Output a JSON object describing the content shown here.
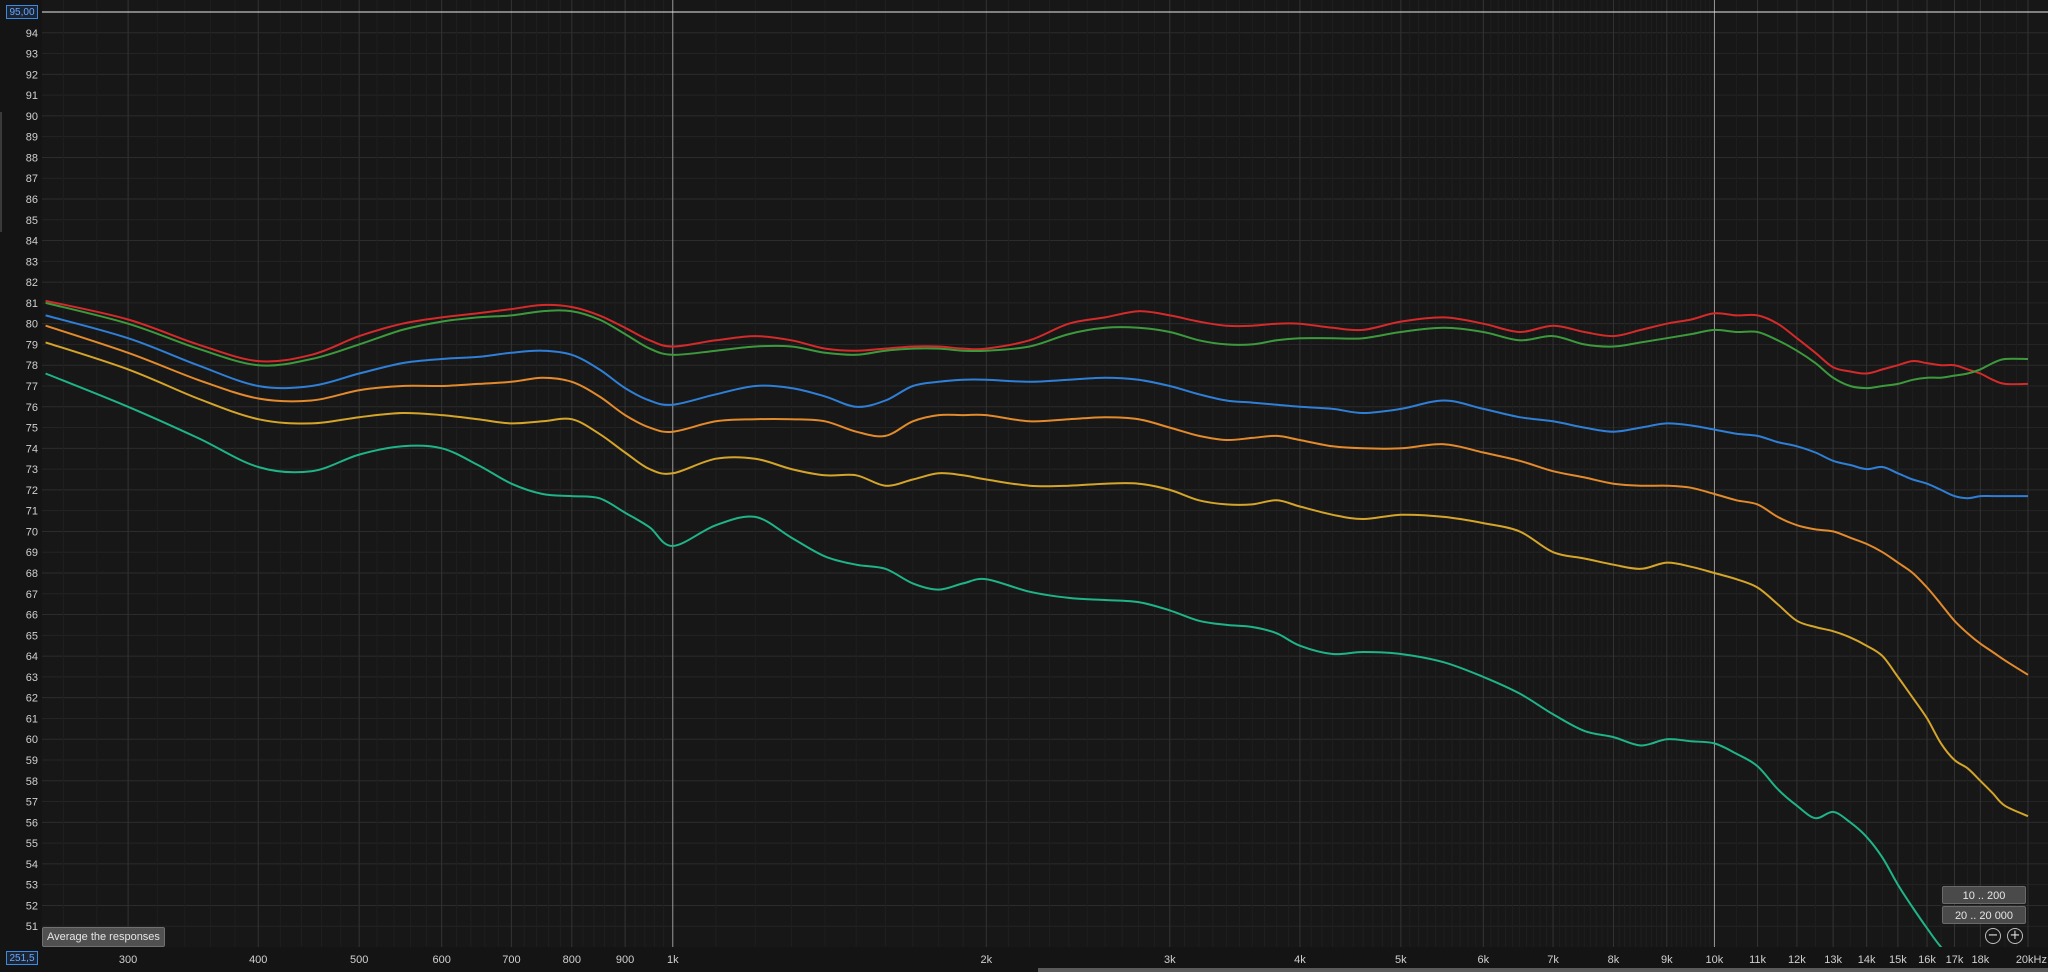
{
  "chart_data": {
    "type": "line",
    "xscale": "log",
    "xlim": [
      248,
      20000
    ],
    "ylim": [
      50,
      95
    ],
    "grid": true,
    "y_ticks": [
      51,
      52,
      53,
      54,
      55,
      56,
      57,
      58,
      59,
      60,
      61,
      62,
      63,
      64,
      65,
      66,
      67,
      68,
      69,
      70,
      71,
      72,
      73,
      74,
      75,
      76,
      77,
      78,
      79,
      80,
      81,
      82,
      83,
      84,
      85,
      86,
      87,
      88,
      89,
      90,
      91,
      92,
      93,
      94
    ],
    "x_ticks": [
      {
        "v": 300,
        "label": "300"
      },
      {
        "v": 400,
        "label": "400"
      },
      {
        "v": 500,
        "label": "500"
      },
      {
        "v": 600,
        "label": "600"
      },
      {
        "v": 700,
        "label": "700"
      },
      {
        "v": 800,
        "label": "800"
      },
      {
        "v": 900,
        "label": "900"
      },
      {
        "v": 1000,
        "label": "1k"
      },
      {
        "v": 2000,
        "label": "2k"
      },
      {
        "v": 3000,
        "label": "3k"
      },
      {
        "v": 4000,
        "label": "4k"
      },
      {
        "v": 5000,
        "label": "5k"
      },
      {
        "v": 6000,
        "label": "6k"
      },
      {
        "v": 7000,
        "label": "7k"
      },
      {
        "v": 8000,
        "label": "8k"
      },
      {
        "v": 9000,
        "label": "9k"
      },
      {
        "v": 10000,
        "label": "10k"
      },
      {
        "v": 11000,
        "label": "11k"
      },
      {
        "v": 12000,
        "label": "12k"
      },
      {
        "v": 13000,
        "label": "13k"
      },
      {
        "v": 14000,
        "label": "14k"
      },
      {
        "v": 15000,
        "label": "15k"
      },
      {
        "v": 16000,
        "label": "16k"
      },
      {
        "v": 17000,
        "label": "17k"
      },
      {
        "v": 18000,
        "label": "18k"
      },
      {
        "v": 20000,
        "label": "20kHz"
      }
    ],
    "x": [
      250,
      300,
      350,
      400,
      450,
      500,
      550,
      600,
      650,
      700,
      750,
      800,
      850,
      900,
      950,
      1000,
      1100,
      1200,
      1300,
      1400,
      1500,
      1600,
      1700,
      1800,
      1900,
      2000,
      2200,
      2400,
      2600,
      2800,
      3000,
      3200,
      3400,
      3600,
      3800,
      4000,
      4300,
      4600,
      5000,
      5500,
      6000,
      6500,
      7000,
      7500,
      8000,
      8500,
      9000,
      9500,
      10000,
      10500,
      11000,
      11500,
      12000,
      12500,
      13000,
      13500,
      14000,
      14500,
      15000,
      15500,
      16000,
      16500,
      17000,
      17500,
      18000,
      18500,
      19000,
      20000
    ],
    "series": [
      {
        "color": "#d42a2a",
        "values": [
          81.1,
          80.2,
          79.0,
          78.2,
          78.5,
          79.4,
          80.0,
          80.3,
          80.5,
          80.7,
          80.9,
          80.8,
          80.4,
          79.8,
          79.2,
          78.9,
          79.2,
          79.4,
          79.2,
          78.8,
          78.7,
          78.8,
          78.9,
          78.9,
          78.8,
          78.8,
          79.2,
          80.0,
          80.3,
          80.6,
          80.4,
          80.1,
          79.9,
          79.9,
          80.0,
          80.0,
          79.8,
          79.7,
          80.1,
          80.3,
          80.0,
          79.6,
          79.9,
          79.6,
          79.4,
          79.7,
          80.0,
          80.2,
          80.5,
          80.4,
          80.4,
          80.0,
          79.3,
          78.6,
          77.9,
          77.7,
          77.6,
          77.8,
          78.0,
          78.2,
          78.1,
          78.0,
          78.0,
          77.8,
          77.6,
          77.3,
          77.1,
          77.1
        ]
      },
      {
        "color": "#3c9a3c",
        "values": [
          81.0,
          80.0,
          78.8,
          78.0,
          78.3,
          79.0,
          79.7,
          80.1,
          80.3,
          80.4,
          80.6,
          80.6,
          80.2,
          79.5,
          78.8,
          78.5,
          78.7,
          78.9,
          78.9,
          78.6,
          78.5,
          78.7,
          78.8,
          78.8,
          78.7,
          78.7,
          78.9,
          79.5,
          79.8,
          79.8,
          79.6,
          79.2,
          79.0,
          79.0,
          79.2,
          79.3,
          79.3,
          79.3,
          79.6,
          79.8,
          79.6,
          79.2,
          79.4,
          79.0,
          78.9,
          79.1,
          79.3,
          79.5,
          79.7,
          79.6,
          79.6,
          79.2,
          78.7,
          78.1,
          77.4,
          77.0,
          76.9,
          77.0,
          77.1,
          77.3,
          77.4,
          77.4,
          77.5,
          77.6,
          77.8,
          78.1,
          78.3,
          78.3
        ]
      },
      {
        "color": "#2f7fd6",
        "values": [
          80.4,
          79.3,
          78.0,
          77.0,
          77.0,
          77.6,
          78.1,
          78.3,
          78.4,
          78.6,
          78.7,
          78.5,
          77.8,
          76.9,
          76.3,
          76.1,
          76.6,
          77.0,
          76.9,
          76.5,
          76.0,
          76.3,
          77.0,
          77.2,
          77.3,
          77.3,
          77.2,
          77.3,
          77.4,
          77.3,
          77.0,
          76.6,
          76.3,
          76.2,
          76.1,
          76.0,
          75.9,
          75.7,
          75.9,
          76.3,
          75.9,
          75.5,
          75.3,
          75.0,
          74.8,
          75.0,
          75.2,
          75.1,
          74.9,
          74.7,
          74.6,
          74.3,
          74.1,
          73.8,
          73.4,
          73.2,
          73.0,
          73.1,
          72.8,
          72.5,
          72.3,
          72.0,
          71.7,
          71.6,
          71.7,
          71.7,
          71.7,
          71.7
        ]
      },
      {
        "color": "#e28a2c",
        "values": [
          79.9,
          78.6,
          77.3,
          76.4,
          76.3,
          76.8,
          77.0,
          77.0,
          77.1,
          77.2,
          77.4,
          77.2,
          76.5,
          75.6,
          75.0,
          74.8,
          75.3,
          75.4,
          75.4,
          75.3,
          74.8,
          74.6,
          75.3,
          75.6,
          75.6,
          75.6,
          75.3,
          75.4,
          75.5,
          75.4,
          75.0,
          74.6,
          74.4,
          74.5,
          74.6,
          74.4,
          74.1,
          74.0,
          74.0,
          74.2,
          73.8,
          73.4,
          72.9,
          72.6,
          72.3,
          72.2,
          72.2,
          72.1,
          71.8,
          71.5,
          71.3,
          70.7,
          70.3,
          70.1,
          70.0,
          69.7,
          69.4,
          69.0,
          68.5,
          68.0,
          67.3,
          66.5,
          65.7,
          65.1,
          64.6,
          64.2,
          63.8,
          63.1
        ]
      },
      {
        "color": "#d4a52a",
        "values": [
          79.1,
          77.8,
          76.4,
          75.4,
          75.2,
          75.5,
          75.7,
          75.6,
          75.4,
          75.2,
          75.3,
          75.4,
          74.7,
          73.8,
          73.0,
          72.8,
          73.5,
          73.5,
          73.0,
          72.7,
          72.7,
          72.2,
          72.5,
          72.8,
          72.7,
          72.5,
          72.2,
          72.2,
          72.3,
          72.3,
          72.0,
          71.5,
          71.3,
          71.3,
          71.5,
          71.2,
          70.8,
          70.6,
          70.8,
          70.7,
          70.4,
          70.0,
          69.0,
          68.7,
          68.4,
          68.2,
          68.5,
          68.3,
          68.0,
          67.7,
          67.3,
          66.5,
          65.7,
          65.4,
          65.2,
          64.9,
          64.5,
          64.0,
          63.0,
          62.0,
          61.0,
          59.8,
          59.0,
          58.6,
          58.0,
          57.4,
          56.8,
          56.3
        ]
      },
      {
        "color": "#1fb487",
        "values": [
          77.6,
          76.0,
          74.5,
          73.1,
          72.9,
          73.7,
          74.1,
          74.0,
          73.2,
          72.3,
          71.8,
          71.7,
          71.6,
          70.9,
          70.2,
          69.3,
          70.3,
          70.7,
          69.7,
          68.8,
          68.4,
          68.2,
          67.5,
          67.2,
          67.5,
          67.7,
          67.1,
          66.8,
          66.7,
          66.6,
          66.2,
          65.7,
          65.5,
          65.4,
          65.1,
          64.5,
          64.1,
          64.2,
          64.1,
          63.7,
          63.0,
          62.2,
          61.2,
          60.4,
          60.1,
          59.7,
          60.0,
          59.9,
          59.8,
          59.3,
          58.7,
          57.6,
          56.8,
          56.2,
          56.5,
          56.0,
          55.3,
          54.3,
          53.0,
          51.9,
          50.9,
          50.0,
          49.4,
          49.0,
          48.8,
          48.6,
          48.5,
          48.4
        ]
      }
    ]
  },
  "readouts": {
    "top": "95,00",
    "bottom": "251,5"
  },
  "buttons": {
    "range_low": "10 .. 200",
    "range_full": "20 .. 20 000",
    "zoom_out": "−",
    "zoom_in": "+"
  },
  "tooltip": "Average the responses"
}
